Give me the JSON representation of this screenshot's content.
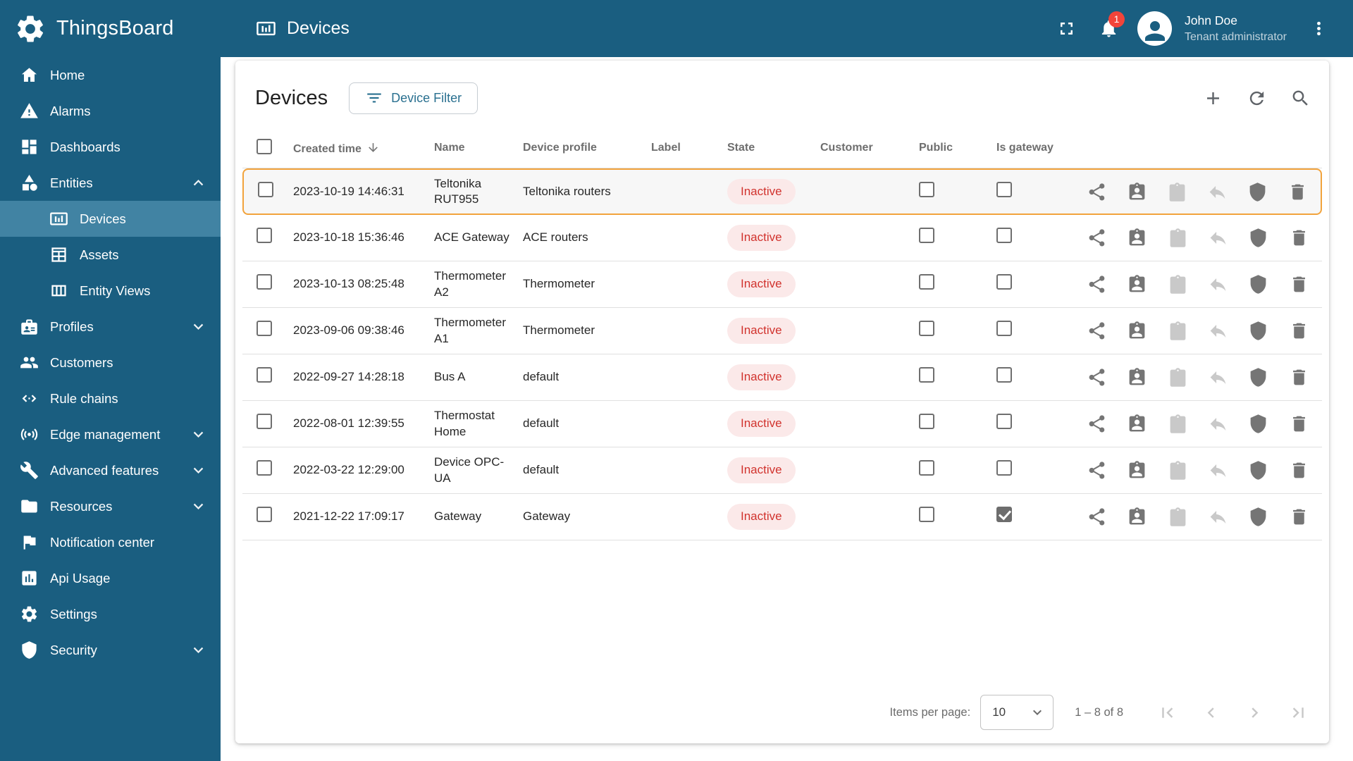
{
  "brand": {
    "name": "ThingsBoard"
  },
  "header": {
    "title": "Devices",
    "notification_badge": "1",
    "user_name": "John Doe",
    "user_role": "Tenant administrator"
  },
  "sidebar": {
    "items": [
      {
        "id": "home",
        "label": "Home",
        "icon": "home-icon"
      },
      {
        "id": "alarms",
        "label": "Alarms",
        "icon": "alarms-icon"
      },
      {
        "id": "dashboards",
        "label": "Dashboards",
        "icon": "dashboards-icon"
      },
      {
        "id": "entities",
        "label": "Entities",
        "icon": "entities-icon",
        "chevron": "up"
      },
      {
        "id": "devices",
        "label": "Devices",
        "icon": "devices-icon",
        "sub": true,
        "selected": true
      },
      {
        "id": "assets",
        "label": "Assets",
        "icon": "assets-icon",
        "sub": true
      },
      {
        "id": "entity-views",
        "label": "Entity Views",
        "icon": "entity-views-icon",
        "sub": true
      },
      {
        "id": "profiles",
        "label": "Profiles",
        "icon": "profiles-icon",
        "chevron": "down"
      },
      {
        "id": "customers",
        "label": "Customers",
        "icon": "customers-icon"
      },
      {
        "id": "rule-chains",
        "label": "Rule chains",
        "icon": "rule-chains-icon"
      },
      {
        "id": "edge-management",
        "label": "Edge management",
        "icon": "edge-management-icon",
        "chevron": "down"
      },
      {
        "id": "advanced-features",
        "label": "Advanced features",
        "icon": "advanced-features-icon",
        "chevron": "down"
      },
      {
        "id": "resources",
        "label": "Resources",
        "icon": "resources-icon",
        "chevron": "down"
      },
      {
        "id": "notification-center",
        "label": "Notification center",
        "icon": "notification-center-icon"
      },
      {
        "id": "api-usage",
        "label": "Api Usage",
        "icon": "api-usage-icon"
      },
      {
        "id": "settings",
        "label": "Settings",
        "icon": "settings-icon"
      },
      {
        "id": "security",
        "label": "Security",
        "icon": "security-icon",
        "chevron": "down"
      }
    ]
  },
  "toolbar": {
    "title": "Devices",
    "filter_button_label": "Device Filter"
  },
  "table": {
    "columns": {
      "created_time": "Created time",
      "name": "Name",
      "device_profile": "Device profile",
      "label": "Label",
      "state": "State",
      "customer": "Customer",
      "public": "Public",
      "is_gateway": "Is gateway"
    },
    "row_actions": [
      {
        "name": "share",
        "icon": "share-icon",
        "disabled": false
      },
      {
        "name": "assign-to-customer",
        "icon": "assign-customer-icon",
        "disabled": false
      },
      {
        "name": "manage-credentials",
        "icon": "credentials-icon",
        "disabled": true
      },
      {
        "name": "unassign",
        "icon": "undo-icon",
        "disabled": true
      },
      {
        "name": "security",
        "icon": "shield-icon",
        "disabled": false
      },
      {
        "name": "delete",
        "icon": "delete-icon",
        "disabled": false
      }
    ],
    "rows": [
      {
        "created_time": "2023-10-19 14:46:31",
        "name": "Teltonika RUT955",
        "device_profile": "Teltonika routers",
        "label": "",
        "state": "Inactive",
        "customer": "",
        "public": false,
        "is_gateway": false,
        "highlighted": true
      },
      {
        "created_time": "2023-10-18 15:36:46",
        "name": "ACE Gateway",
        "device_profile": "ACE routers",
        "label": "",
        "state": "Inactive",
        "customer": "",
        "public": false,
        "is_gateway": false
      },
      {
        "created_time": "2023-10-13 08:25:48",
        "name": "Thermometer A2",
        "device_profile": "Thermometer",
        "label": "",
        "state": "Inactive",
        "customer": "",
        "public": false,
        "is_gateway": false
      },
      {
        "created_time": "2023-09-06 09:38:46",
        "name": "Thermometer A1",
        "device_profile": "Thermometer",
        "label": "",
        "state": "Inactive",
        "customer": "",
        "public": false,
        "is_gateway": false
      },
      {
        "created_time": "2022-09-27 14:28:18",
        "name": "Bus A",
        "device_profile": "default",
        "label": "",
        "state": "Inactive",
        "customer": "",
        "public": false,
        "is_gateway": false
      },
      {
        "created_time": "2022-08-01 12:39:55",
        "name": "Thermostat Home",
        "device_profile": "default",
        "label": "",
        "state": "Inactive",
        "customer": "",
        "public": false,
        "is_gateway": false
      },
      {
        "created_time": "2022-03-22 12:29:00",
        "name": "Device OPC-UA",
        "device_profile": "default",
        "label": "",
        "state": "Inactive",
        "customer": "",
        "public": false,
        "is_gateway": false
      },
      {
        "created_time": "2021-12-22 17:09:17",
        "name": "Gateway",
        "device_profile": "Gateway",
        "label": "",
        "state": "Inactive",
        "customer": "",
        "public": false,
        "is_gateway": true
      }
    ]
  },
  "pagination": {
    "items_per_page_label": "Items per page:",
    "items_per_page_value": "10",
    "range_label": "1 – 8 of 8"
  },
  "colors": {
    "primary": "#1a5e80",
    "selected": "#4183a3",
    "highlight": "#f2a33c",
    "inactive_text": "#d1332e",
    "inactive_bg": "#fbe9e9"
  }
}
